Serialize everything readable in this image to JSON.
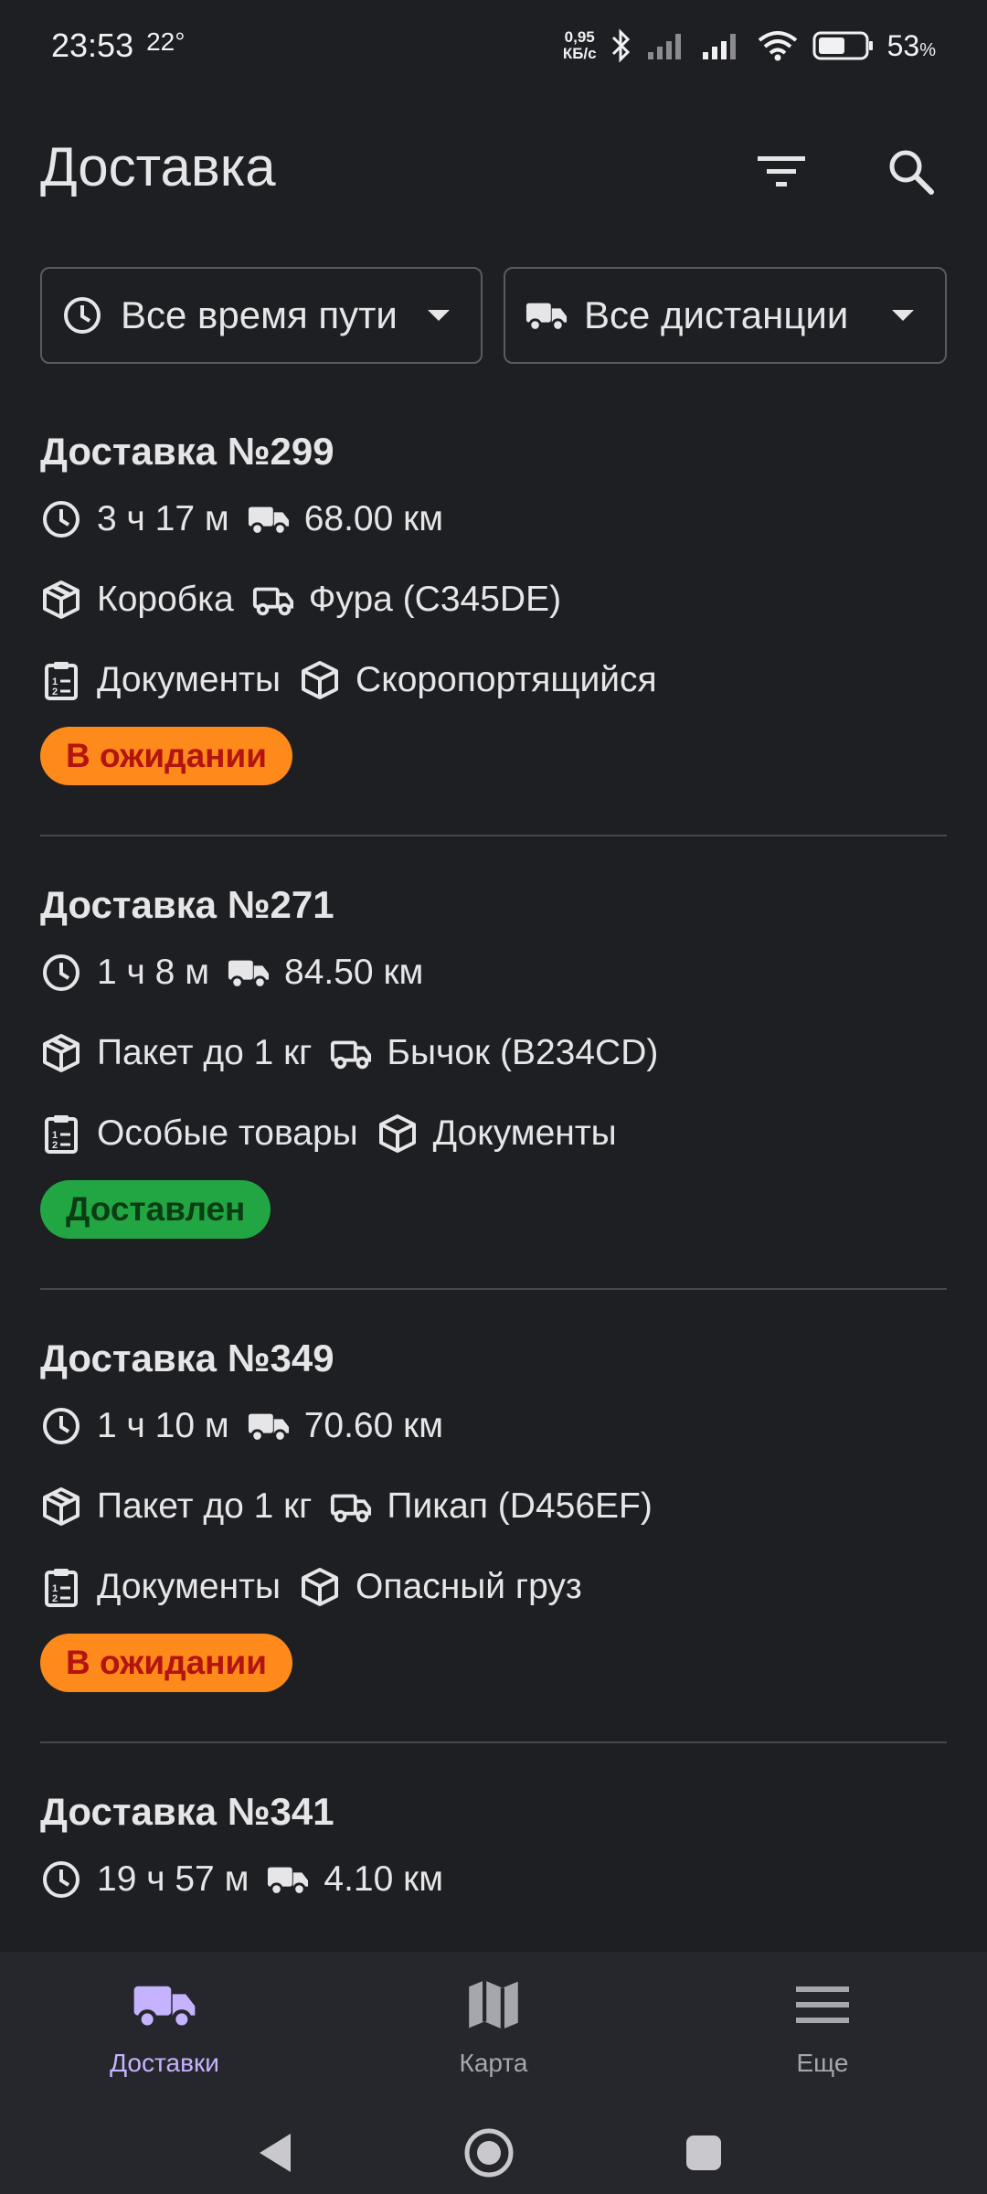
{
  "status_bar": {
    "time": "23:53",
    "temperature": "22°",
    "net_speed_value": "0,95",
    "net_speed_unit": "КБ/с",
    "battery": "53",
    "battery_unit": "%"
  },
  "header": {
    "title": "Доставка",
    "icons": [
      "filter-icon",
      "search-icon"
    ]
  },
  "filters": {
    "time": {
      "label": "Все время пути",
      "icon": "clock-icon"
    },
    "distance": {
      "label": "Все дистанции",
      "icon": "truck-icon"
    }
  },
  "deliveries": [
    {
      "title": "Доставка №299",
      "duration": "3 ч 17 м",
      "distance": "68.00 км",
      "package": "Коробка",
      "vehicle": "Фура (C345DE)",
      "category1": "Документы",
      "category2": "Скоропортящийся",
      "status": "В ожидании",
      "status_colors": {
        "bg": "#ff8a1c",
        "fg": "#b3140f"
      }
    },
    {
      "title": "Доставка №271",
      "duration": "1 ч 8 м",
      "distance": "84.50 км",
      "package": "Пакет до 1 кг",
      "vehicle": "Бычок (B234CD)",
      "category1": "Особые товары",
      "category2": "Документы",
      "status": "Доставлен",
      "status_colors": {
        "bg": "#22a644",
        "fg": "#0b3d14"
      }
    },
    {
      "title": "Доставка №349",
      "duration": "1 ч 10 м",
      "distance": "70.60 км",
      "package": "Пакет до 1 кг",
      "vehicle": "Пикап (D456EF)",
      "category1": "Документы",
      "category2": "Опасный груз",
      "status": "В ожидании",
      "status_colors": {
        "bg": "#ff8a1c",
        "fg": "#b3140f"
      }
    },
    {
      "title": "Доставка №341",
      "duration": "19 ч 57 м",
      "distance": "4.10 км"
    }
  ],
  "bottom_nav": {
    "items": [
      {
        "label": "Доставки",
        "icon": "truck-icon",
        "active": true
      },
      {
        "label": "Карта",
        "icon": "map-icon",
        "active": false
      },
      {
        "label": "Еще",
        "icon": "menu-icon",
        "active": false
      }
    ]
  },
  "colors": {
    "background": "#1e1f23",
    "accent": "#c5b3ff",
    "nav_background": "#26272c"
  }
}
